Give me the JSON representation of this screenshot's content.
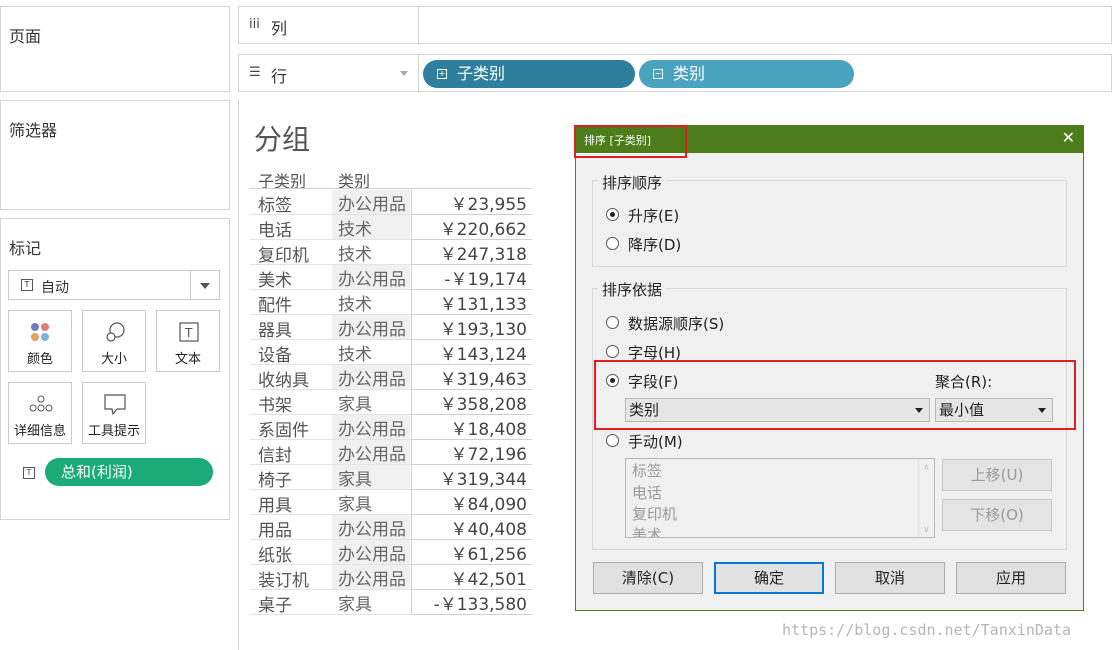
{
  "left": {
    "pages_title": "页面",
    "filters_title": "筛选器",
    "marks_title": "标记",
    "mark_type": "自动",
    "mark_buttons": [
      {
        "label": "颜色",
        "icon": "color-dots-icon"
      },
      {
        "label": "大小",
        "icon": "size-circles-icon"
      },
      {
        "label": "文本",
        "icon": "text-box-icon"
      },
      {
        "label": "详细信息",
        "icon": "detail-dots-icon"
      },
      {
        "label": "工具提示",
        "icon": "tooltip-icon"
      }
    ],
    "measure_pill": "总和(利润)",
    "pill_color": "#1aab78"
  },
  "shelves": {
    "columns_label": "列",
    "rows_label": "行",
    "row_pills": [
      {
        "label": "子类别",
        "color": "#2e7f9e"
      },
      {
        "label": "类别",
        "color": "#4aa3be"
      }
    ]
  },
  "view": {
    "title": "分组",
    "col_headers": [
      "子类别",
      "类别"
    ],
    "rows": [
      {
        "sub": "标签",
        "cat": "办公用品",
        "val": "￥23,955"
      },
      {
        "sub": "电话",
        "cat": "技术",
        "val": "￥220,662"
      },
      {
        "sub": "复印机",
        "cat": "技术",
        "val": "￥247,318"
      },
      {
        "sub": "美术",
        "cat": "办公用品",
        "val": "-￥19,174"
      },
      {
        "sub": "配件",
        "cat": "技术",
        "val": "￥131,133"
      },
      {
        "sub": "器具",
        "cat": "办公用品",
        "val": "￥193,130"
      },
      {
        "sub": "设备",
        "cat": "技术",
        "val": "￥143,124"
      },
      {
        "sub": "收纳具",
        "cat": "办公用品",
        "val": "￥319,463"
      },
      {
        "sub": "书架",
        "cat": "家具",
        "val": "￥358,208"
      },
      {
        "sub": "系固件",
        "cat": "办公用品",
        "val": "￥18,408"
      },
      {
        "sub": "信封",
        "cat": "办公用品",
        "val": "￥72,196"
      },
      {
        "sub": "椅子",
        "cat": "家具",
        "val": "￥319,344"
      },
      {
        "sub": "用具",
        "cat": "家具",
        "val": "￥84,090"
      },
      {
        "sub": "用品",
        "cat": "办公用品",
        "val": "￥40,408"
      },
      {
        "sub": "纸张",
        "cat": "办公用品",
        "val": "￥61,256"
      },
      {
        "sub": "装订机",
        "cat": "办公用品",
        "val": "￥42,501"
      },
      {
        "sub": "桌子",
        "cat": "家具",
        "val": "-￥133,580"
      }
    ]
  },
  "dialog": {
    "title": "排序 [子类别]",
    "titlebar_color": "#4c7d1a",
    "order_group": "排序顺序",
    "asc": "升序(E)",
    "desc": "降序(D)",
    "by_group": "排序依据",
    "opt_datasource": "数据源顺序(S)",
    "opt_alpha": "字母(H)",
    "opt_field": "字段(F)",
    "agg_label": "聚合(R):",
    "field_value": "类别",
    "agg_value": "最小值",
    "opt_manual": "手动(M)",
    "manual_items": [
      "标签",
      "电话",
      "复印机",
      "美术"
    ],
    "move_up": "上移(U)",
    "move_down": "下移(O)",
    "clear": "清除(C)",
    "ok": "确定",
    "cancel": "取消",
    "apply": "应用"
  },
  "watermark": "https://blog.csdn.net/TanxinData",
  "highlight_color": "#e02020"
}
